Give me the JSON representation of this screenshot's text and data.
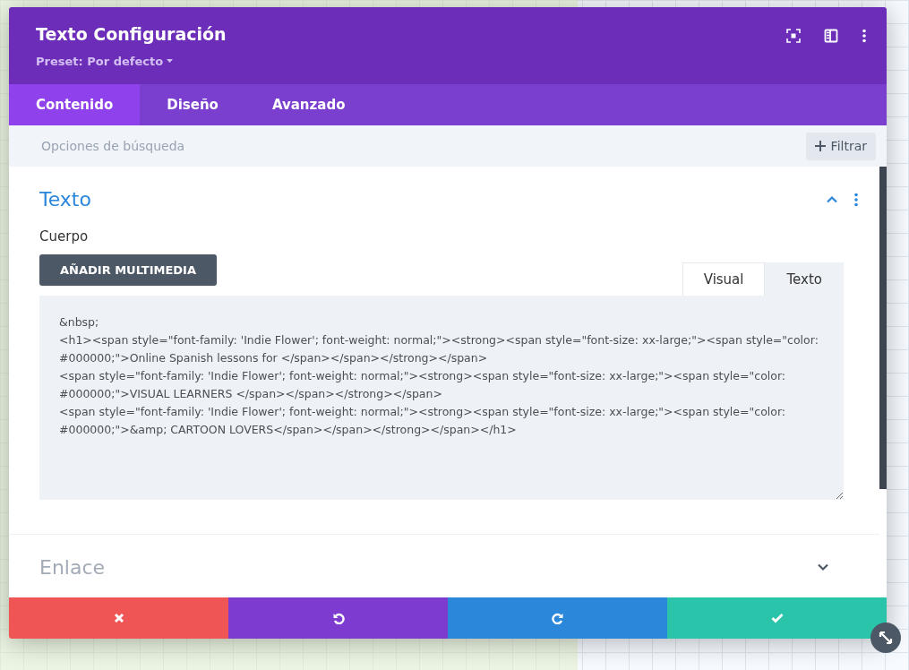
{
  "modal": {
    "title": "Texto Configuración",
    "preset": "Preset: Por defecto",
    "tabs": [
      {
        "label": "Contenido",
        "selected": true
      },
      {
        "label": "Diseño",
        "selected": false
      },
      {
        "label": "Avanzado",
        "selected": false
      }
    ],
    "search": {
      "placeholder": "Opciones de búsqueda"
    },
    "filter_button": "Filtrar",
    "sections": [
      {
        "title": "Texto",
        "expanded": true,
        "field_label": "Cuerpo",
        "media_button": "AÑADIR MULTIMEDIA",
        "editor_tabs": [
          {
            "label": "Visual",
            "selected": false
          },
          {
            "label": "Texto",
            "selected": true
          }
        ],
        "content": "&nbsp;\n<h1><span style=\"font-family: 'Indie Flower'; font-weight: normal;\"><strong><span style=\"font-size: xx-large;\"><span style=\"color: #000000;\">Online Spanish lessons for </span></span></strong></span>\n<span style=\"font-family: 'Indie Flower'; font-weight: normal;\"><strong><span style=\"font-size: xx-large;\"><span style=\"color: #000000;\">VISUAL LEARNERS </span></span></strong></span>\n<span style=\"font-family: 'Indie Flower'; font-weight: normal;\"><strong><span style=\"font-size: xx-large;\"><span style=\"color: #000000;\">&amp; CARTOON LOVERS</span></span></strong></span></h1>"
      },
      {
        "title": "Enlace",
        "expanded": false
      }
    ],
    "footer_buttons": [
      {
        "kind": "cancel"
      },
      {
        "kind": "undo"
      },
      {
        "kind": "redo"
      },
      {
        "kind": "save"
      }
    ]
  }
}
